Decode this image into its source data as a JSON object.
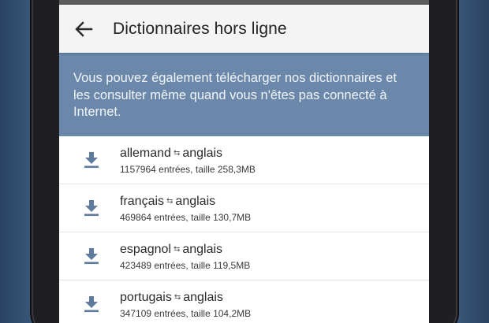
{
  "toolbar": {
    "title": "Dictionnaires hors ligne",
    "back_icon": "arrow-left-icon"
  },
  "banner": {
    "text": "Vous pouvez également télécharger nos dictionnaires et les consulter même quand vous n'êtes pas connecté à Internet."
  },
  "dictionaries": [
    {
      "from": "allemand",
      "separator": "⇆",
      "to": "anglais",
      "details": "1157964 entrées, taille 258,3MB"
    },
    {
      "from": "français",
      "separator": "⇆",
      "to": "anglais",
      "details": "469864 entrées, taille 130,7MB"
    },
    {
      "from": "espagnol",
      "separator": "⇆",
      "to": "anglais",
      "details": "423489 entrées, taille 119,5MB"
    },
    {
      "from": "portugais",
      "separator": "⇆",
      "to": "anglais",
      "details": "347109 entrées, taille 104,2MB"
    }
  ],
  "colors": {
    "background": "#3d5b7e",
    "banner": "#6b88aa",
    "icon": "#5e7b9e",
    "toolbar": "#f4f4f4"
  }
}
